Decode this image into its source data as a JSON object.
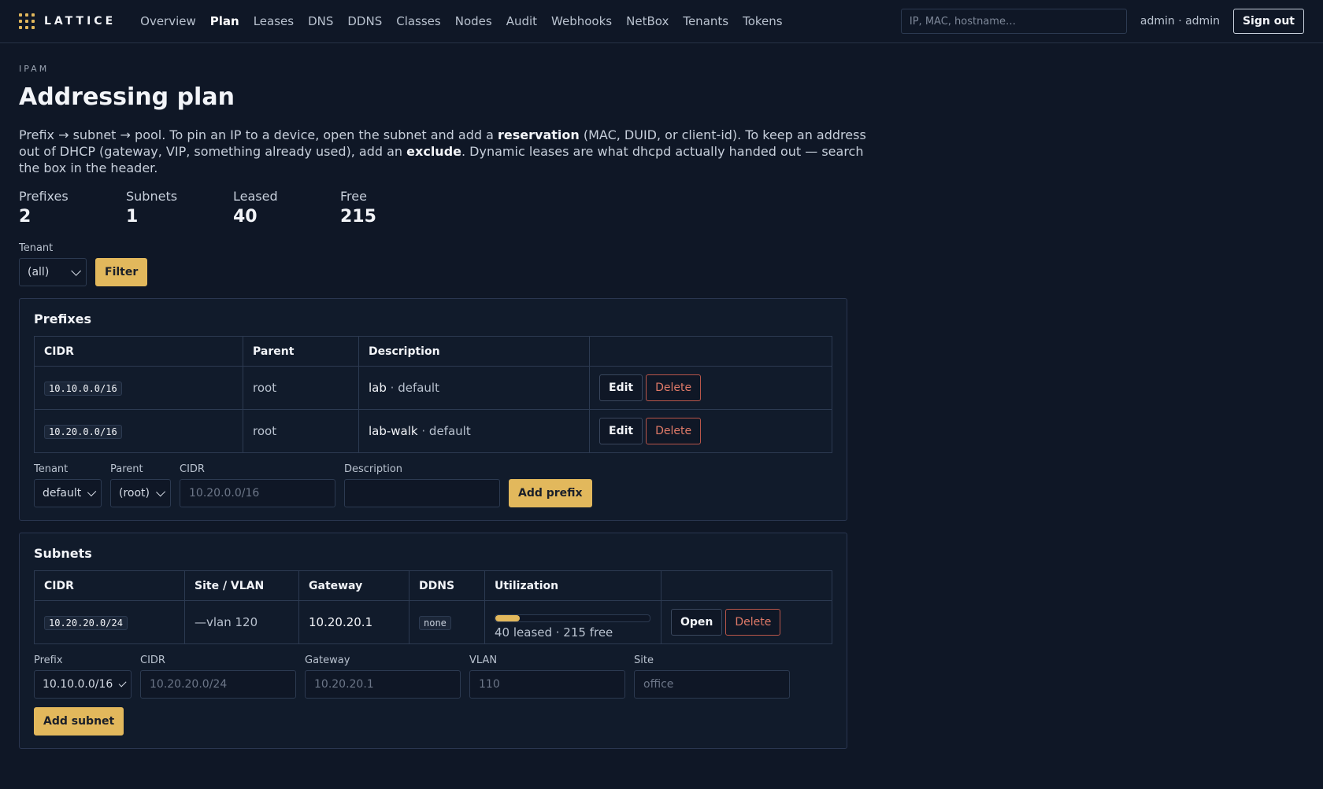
{
  "brand": {
    "name": "LATTICE"
  },
  "nav": [
    {
      "label": "Overview",
      "active": false
    },
    {
      "label": "Plan",
      "active": true
    },
    {
      "label": "Leases",
      "active": false
    },
    {
      "label": "DNS",
      "active": false
    },
    {
      "label": "DDNS",
      "active": false
    },
    {
      "label": "Classes",
      "active": false
    },
    {
      "label": "Nodes",
      "active": false
    },
    {
      "label": "Audit",
      "active": false
    },
    {
      "label": "Webhooks",
      "active": false
    },
    {
      "label": "NetBox",
      "active": false
    },
    {
      "label": "Tenants",
      "active": false
    },
    {
      "label": "Tokens",
      "active": false
    }
  ],
  "header": {
    "search_placeholder": "IP, MAC, hostname…",
    "user": "admin · admin",
    "signout_label": "Sign out"
  },
  "page": {
    "eyebrow": "IPAM",
    "title": "Addressing plan",
    "intro_1": "Prefix → subnet → pool. To pin an IP to a device, open the subnet and add a ",
    "intro_bold_1": "reservation",
    "intro_2": " (MAC, DUID, or client-id). To keep an address out of DHCP (gateway, VIP, something already used), add an ",
    "intro_bold_2": "exclude",
    "intro_3": ". Dynamic leases are what dhcpd actually handed out — search the box in the header."
  },
  "stats": [
    {
      "label": "Prefixes",
      "value": "2"
    },
    {
      "label": "Subnets",
      "value": "1"
    },
    {
      "label": "Leased",
      "value": "40"
    },
    {
      "label": "Free",
      "value": "215"
    }
  ],
  "filter": {
    "label": "Tenant",
    "value": "(all)",
    "button": "Filter"
  },
  "prefixes": {
    "title": "Prefixes",
    "headers": [
      "CIDR",
      "Parent",
      "Description",
      ""
    ],
    "rows": [
      {
        "cidr": "10.10.0.0/16",
        "parent": "root",
        "desc": "lab",
        "tenant": "default"
      },
      {
        "cidr": "10.20.0.0/16",
        "parent": "root",
        "desc": "lab-walk",
        "tenant": "default"
      }
    ],
    "edit_label": "Edit",
    "delete_label": "Delete",
    "form": {
      "tenant_label": "Tenant",
      "tenant_value": "default",
      "parent_label": "Parent",
      "parent_value": "(root)",
      "cidr_label": "CIDR",
      "cidr_placeholder": "10.20.0.0/16",
      "desc_label": "Description",
      "desc_placeholder": "",
      "add_label": "Add prefix"
    }
  },
  "subnets": {
    "title": "Subnets",
    "headers": [
      "CIDR",
      "Site / VLAN",
      "Gateway",
      "DDNS",
      "Utilization",
      ""
    ],
    "rows": [
      {
        "cidr": "10.20.20.0/24",
        "site_vlan": "—vlan 120",
        "gateway": "10.20.20.1",
        "ddns": "none",
        "utilization": 0.157,
        "util_text": "40 leased · 215 free"
      }
    ],
    "open_label": "Open",
    "delete_label": "Delete",
    "form": {
      "prefix_label": "Prefix",
      "prefix_value": "10.10.0.0/16",
      "cidr_label": "CIDR",
      "cidr_placeholder": "10.20.20.0/24",
      "gateway_label": "Gateway",
      "gateway_placeholder": "10.20.20.1",
      "vlan_label": "VLAN",
      "vlan_placeholder": "110",
      "site_label": "Site",
      "site_placeholder": "office",
      "add_label": "Add subnet"
    }
  },
  "colors": {
    "accent": "#e2b85c",
    "danger": "#e07a68",
    "background": "#0f1726"
  }
}
